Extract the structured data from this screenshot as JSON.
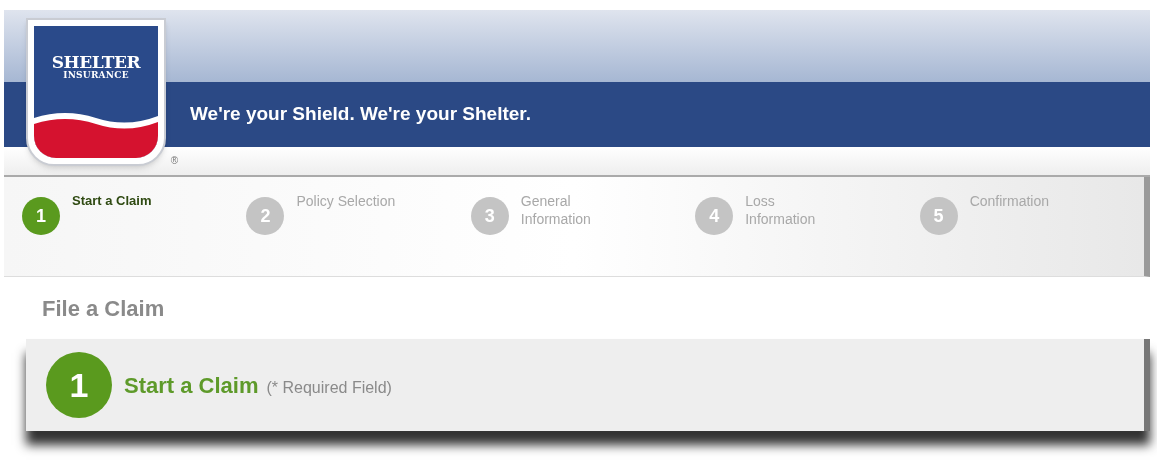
{
  "header": {
    "logo": {
      "name": "SHELTER",
      "sub": "INSURANCE",
      "mark": "®"
    },
    "tagline": "We're your Shield. We're your Shelter."
  },
  "steps": [
    {
      "number": "1",
      "label_lines": [
        "Start a Claim"
      ],
      "selected": true
    },
    {
      "number": "2",
      "label_lines": [
        "Policy Selection"
      ],
      "selected": false
    },
    {
      "number": "3",
      "label_lines": [
        "General",
        "Information"
      ],
      "selected": false
    },
    {
      "number": "4",
      "label_lines": [
        "Loss",
        "Information"
      ],
      "selected": false
    },
    {
      "number": "5",
      "label_lines": [
        "Confirmation"
      ],
      "selected": false
    }
  ],
  "page_title": "File a Claim",
  "section": {
    "number": "1",
    "title": "Start a Claim",
    "note": "(* Required Field)"
  }
}
